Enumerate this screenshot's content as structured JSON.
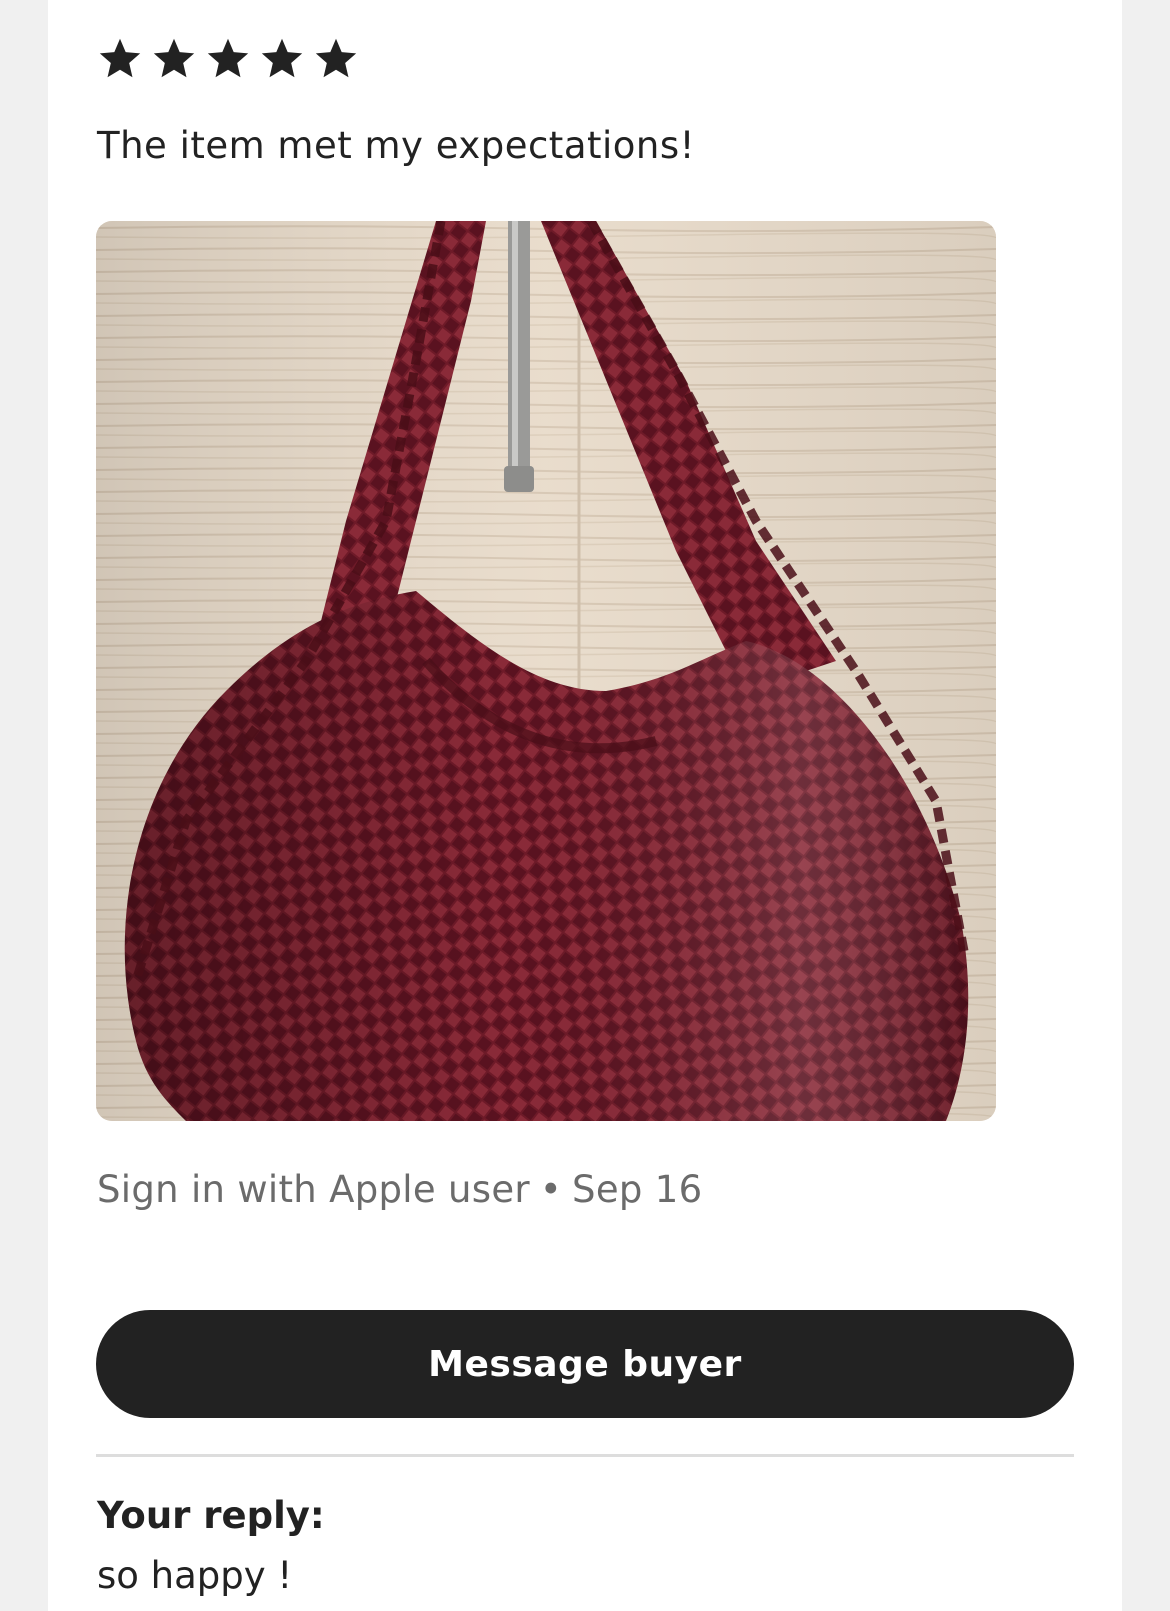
{
  "review": {
    "rating": 5,
    "max_rating": 5,
    "text": "The item met my expectations!",
    "photo_icon": "handbag-photo",
    "reviewer": "Sign in with Apple user",
    "separator": "•",
    "date": "Sep 16"
  },
  "actions": {
    "message_buyer_label": "Message buyer"
  },
  "reply": {
    "label": "Your reply:",
    "text": "so happy !"
  },
  "colors": {
    "page_background": "#f0f0f0",
    "card_background": "#ffffff",
    "star": "#222222",
    "button_background": "#222222",
    "button_text": "#ffffff",
    "meta_text": "#6b6b6b",
    "bag": "#6e1a28"
  }
}
